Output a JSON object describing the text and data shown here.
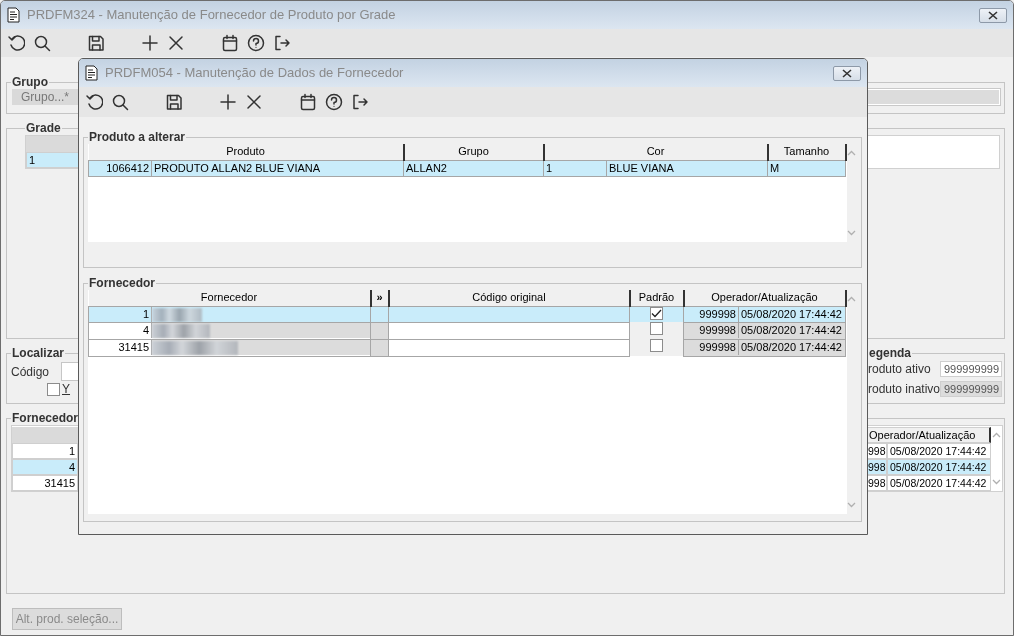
{
  "main_window": {
    "title": "PRDFM324 - Manutenção de Fornecedor de Produto por Grade",
    "grupo": {
      "legend": "Grupo",
      "button": "Grupo...*"
    },
    "grade": {
      "legend": "Grade",
      "rows": [
        {
          "value": "1",
          "selected": true
        }
      ]
    },
    "localizar": {
      "legend": "Localizar",
      "codigo_label": "Código",
      "checkbox": {
        "label": "Y",
        "checked": false
      }
    },
    "legenda": {
      "legend": "egenda",
      "items": [
        {
          "kind": "active",
          "label": "roduto ativo",
          "sample": "999999999"
        },
        {
          "kind": "inactive",
          "label": "roduto inativo",
          "sample": "999999999"
        }
      ]
    },
    "fornecedor": {
      "legend": "Fornecedor",
      "operator_header": "Operador/Atualização",
      "rows": [
        {
          "code": "1",
          "operator": "998",
          "updated": "05/08/2020 17:44:42",
          "selected": false
        },
        {
          "code": "4",
          "operator": "998",
          "updated": "05/08/2020 17:44:42",
          "selected": true
        },
        {
          "code": "31415",
          "operator": "998",
          "updated": "05/08/2020 17:44:42",
          "selected": false
        }
      ]
    },
    "alt_button": {
      "label": "Alt. prod. seleção...",
      "disabled": true
    }
  },
  "dialog": {
    "title": "PRDFM054 - Manutenção de Dados de Fornecedor",
    "produto": {
      "legend": "Produto a alterar",
      "columns": [
        "Produto",
        "Grupo",
        "Cor",
        "Tamanho"
      ],
      "rows": [
        {
          "selected": true,
          "produto": {
            "code": "1066412",
            "name": "PRODUTO ALLAN2 BLUE VIANA"
          },
          "grupo": "ALLAN2",
          "cor": {
            "code": "1",
            "name": "BLUE VIANA"
          },
          "tamanho": "M"
        }
      ]
    },
    "fornecedor": {
      "legend": "Fornecedor",
      "columns": [
        "Fornecedor",
        "»",
        "Código original",
        "Padrão",
        "Operador/Atualização"
      ],
      "rows": [
        {
          "selected": true,
          "code": "1",
          "padrao": true,
          "operator": "999998",
          "updated": "05/08/2020 17:44:42"
        },
        {
          "selected": false,
          "code": "4",
          "padrao": false,
          "operator": "999998",
          "updated": "05/08/2020 17:44:42"
        },
        {
          "selected": false,
          "code": "31415",
          "padrao": false,
          "operator": "999998",
          "updated": "05/08/2020 17:44:42"
        }
      ]
    }
  }
}
